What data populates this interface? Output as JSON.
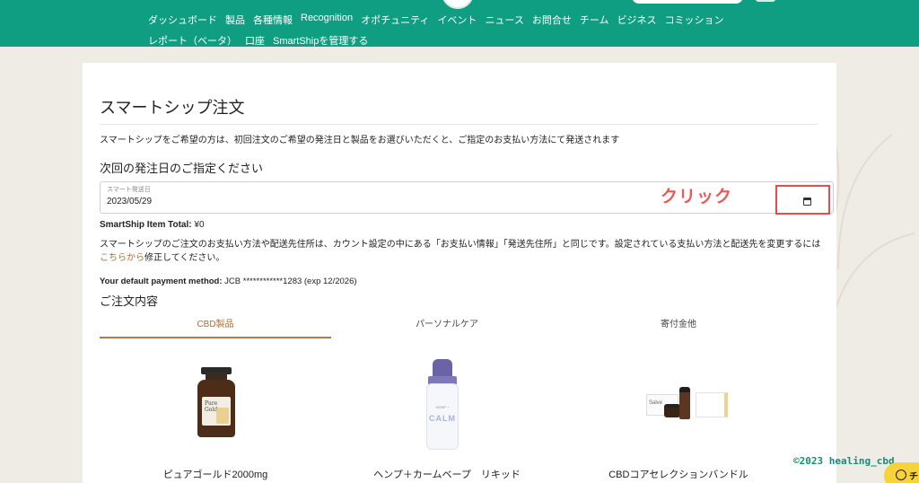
{
  "nav": {
    "row1": [
      "ダッシュボード",
      "製品",
      "各種情報",
      "Recognition",
      "オポチュニティ",
      "イベント",
      "ニュース",
      "お問合せ",
      "チーム",
      "ビジネス",
      "コミッション"
    ],
    "row2": [
      "レポート（ベータ）",
      "口座",
      "SmartShipを管理する"
    ]
  },
  "page": {
    "title": "スマートシップ注文",
    "description": "スマートシップをご希望の方は、初回注文のご希望の発注日と製品をお選びいただくと、ご指定のお支払い方法にて発送されます",
    "next_date_heading": "次回の発注日のご指定ください",
    "date_field_label": "スマート発送日",
    "date_value": "2023/05/29",
    "click_annotation": "クリック",
    "item_total_label": "SmartShip Item Total:",
    "item_total_value": "¥0",
    "notice_text": "スマートシップのご注文のお支払い方法や配送先住所は、カウント設定の中にある「お支払い情報」「発送先住所」と同じです。設定されている支払い方法と配送先を変更するには",
    "notice_link": "こちらから",
    "notice_suffix": "修正してください。",
    "payment_label": "Your default payment method:",
    "payment_value": "JCB ************1283 (exp 12/2026)",
    "order_heading": "ご注文内容"
  },
  "tabs": [
    "CBD製品",
    "パーソナルケア",
    "寄付金他"
  ],
  "products": [
    {
      "name": "ピュアゴールド2000mg",
      "label": "Pure Gold"
    },
    {
      "name": "ヘンプ＋カームベープ　リキッド",
      "label": "CALM",
      "sublabel": "HEMP +"
    },
    {
      "name": "CBDコアセレクションバンドル",
      "label": "Salve"
    }
  ],
  "watermark": "©2023 healing_cbd",
  "chat": {
    "label": "チ"
  },
  "colors": {
    "nav_bg": "#0f9e82",
    "accent": "#b86a2e",
    "callout": "#e55a5a"
  }
}
